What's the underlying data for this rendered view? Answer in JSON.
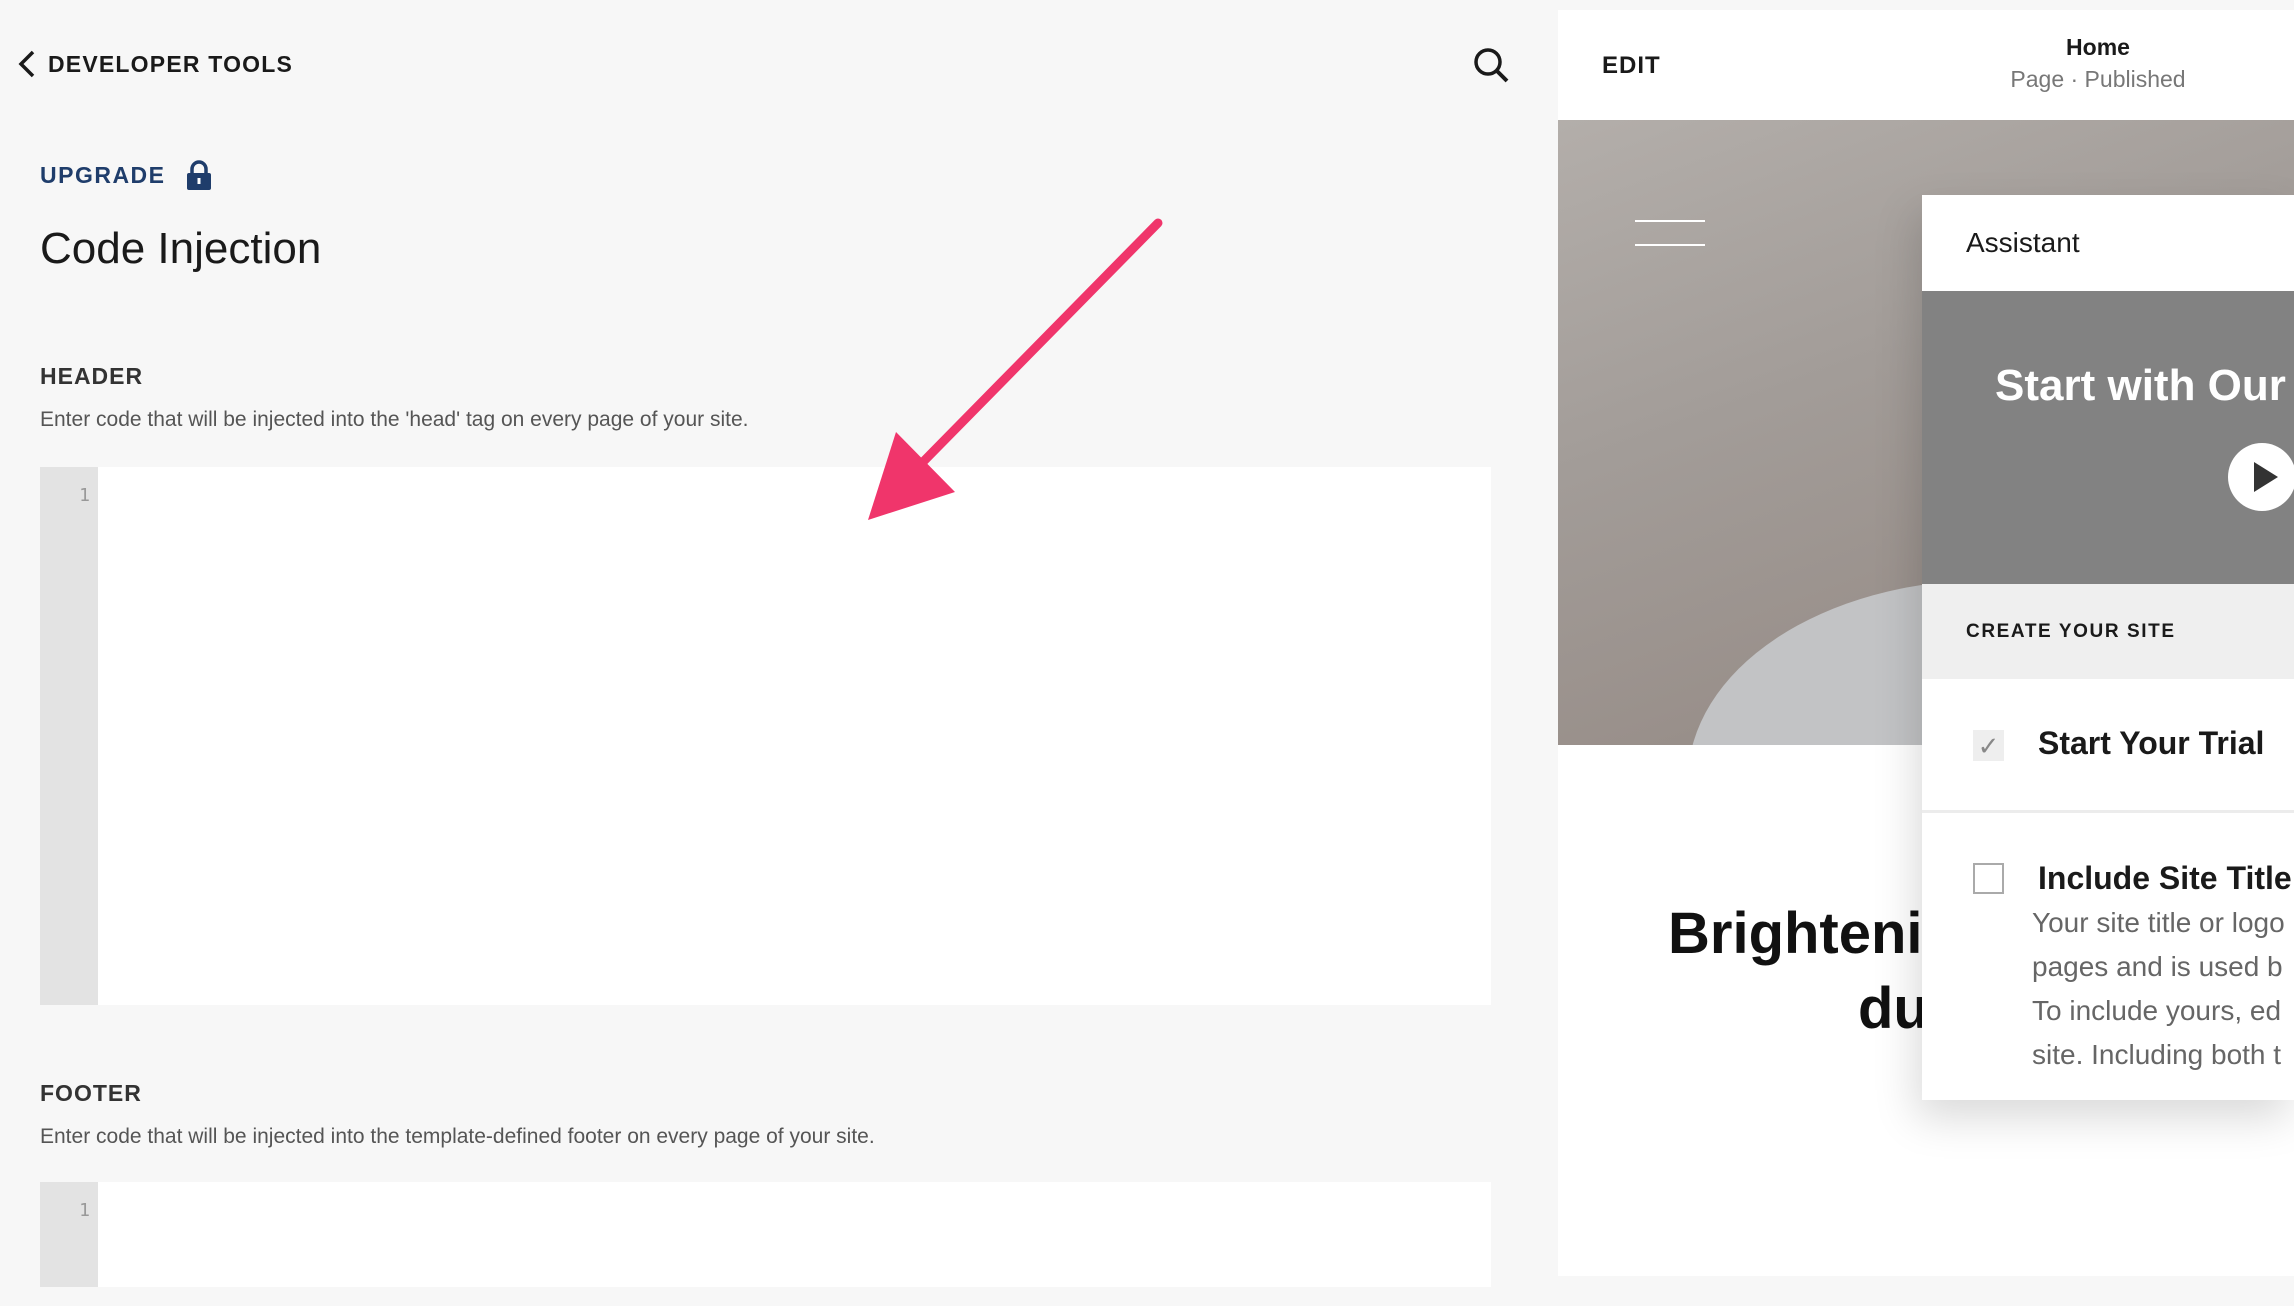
{
  "nav": {
    "back_label": "DEVELOPER TOOLS",
    "search_icon": "search-icon"
  },
  "upgrade": {
    "label": "UPGRADE",
    "icon": "lock-icon",
    "color": "#1f3d6b"
  },
  "page_title": "Code Injection",
  "header_section": {
    "title": "HEADER",
    "description": "Enter code that will be injected into the 'head' tag on every page of your site.",
    "line_number": "1",
    "value": ""
  },
  "footer_section": {
    "title": "FOOTER",
    "description": "Enter code that will be injected into the template-defined footer on every page of your site.",
    "line_number": "1",
    "value": ""
  },
  "annotation": {
    "arrow_color": "#f0356b"
  },
  "preview": {
    "edit_label": "EDIT",
    "page_name": "Home",
    "page_status": "Page · Published",
    "heading_line1": "Brightenin",
    "heading_line2": "du"
  },
  "assistant": {
    "title": "Assistant",
    "video_title": "Start with Our",
    "section_label": "CREATE YOUR SITE",
    "items": [
      {
        "label": "Start Your Trial",
        "checked": true
      },
      {
        "label": "Include Site Title",
        "checked": false,
        "description_lines": [
          "Your site title or logo",
          "pages and is used b",
          "To include yours, ed",
          "site. Including both t"
        ]
      }
    ]
  }
}
